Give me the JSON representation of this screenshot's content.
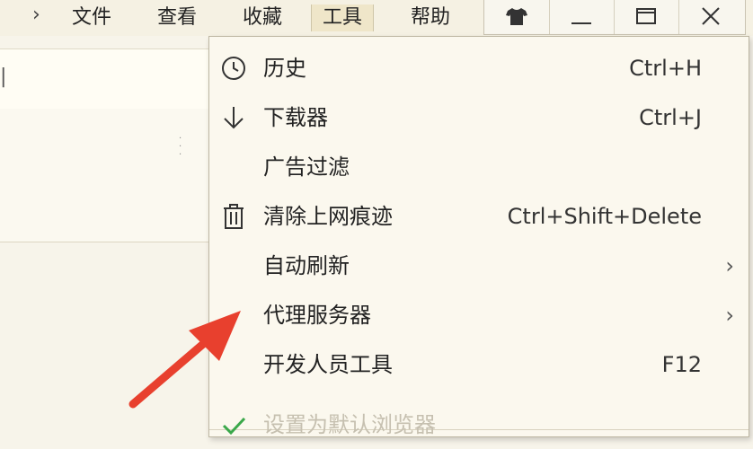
{
  "menubar": {
    "items": [
      {
        "label": "文件"
      },
      {
        "label": "查看"
      },
      {
        "label": "收藏"
      },
      {
        "label": "工具"
      },
      {
        "label": "帮助"
      }
    ]
  },
  "tools_menu": {
    "items": [
      {
        "label": "历史",
        "shortcut": "Ctrl+H",
        "icon": "clock-icon"
      },
      {
        "label": "下载器",
        "shortcut": "Ctrl+J",
        "icon": "download-arrow-icon"
      },
      {
        "label": "广告过滤",
        "shortcut": "",
        "icon": ""
      },
      {
        "label": "清除上网痕迹",
        "shortcut": "Ctrl+Shift+Delete",
        "icon": "trash-icon"
      },
      {
        "label": "自动刷新",
        "shortcut": "",
        "icon": "",
        "submenu": "›"
      },
      {
        "label": "代理服务器",
        "shortcut": "",
        "icon": "",
        "submenu": "›"
      },
      {
        "label": "开发人员工具",
        "shortcut": "F12",
        "icon": ""
      },
      {
        "label": "设置为默认浏览器",
        "shortcut": "",
        "icon": "checkmark-icon",
        "disabled": true
      }
    ]
  },
  "colors": {
    "annotation_arrow": "#e8402e",
    "checkmark": "#3aa84a",
    "active_menu_bg": "#efe6c9"
  }
}
